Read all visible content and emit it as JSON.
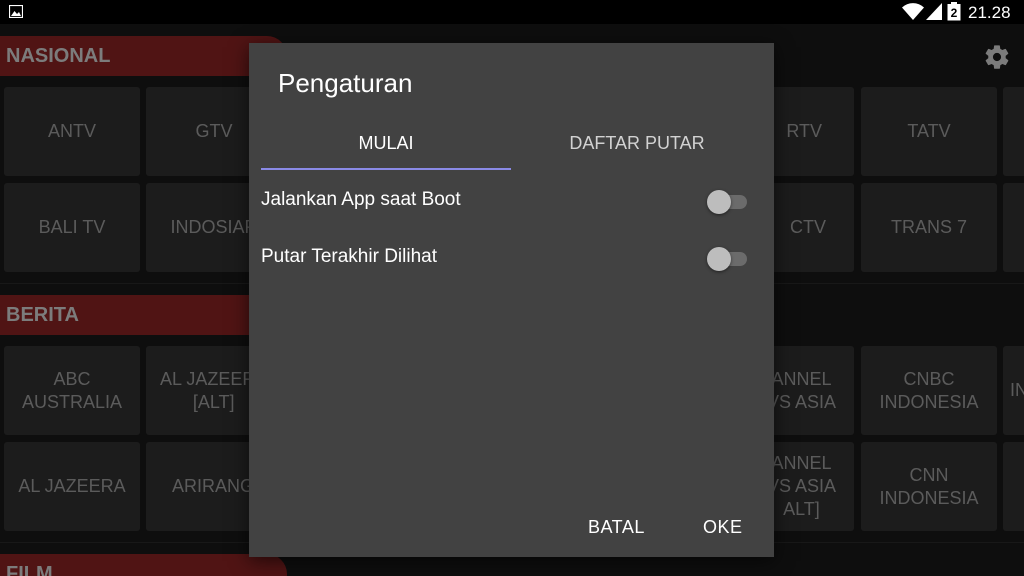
{
  "status_bar": {
    "time": "21.28",
    "icons": [
      "gallery-icon",
      "wifi-icon",
      "signal-icon",
      "battery-icon"
    ]
  },
  "categories": [
    {
      "title": "NASIONAL",
      "rows": [
        [
          "ANTV",
          "GTV",
          "",
          "",
          "",
          "RTV",
          "TATV"
        ],
        [
          "BALI TV",
          "INDOSIAR",
          "",
          "",
          "",
          "CTV",
          "TRANS 7"
        ]
      ]
    },
    {
      "title": "BERITA",
      "rows": [
        [
          "ABC\nAUSTRALIA",
          "AL JAZEERA\n[ALT]",
          "",
          "",
          "",
          "ANNEL\nVS ASIA",
          "CNBC\nINDONESIA",
          "IN"
        ],
        [
          "AL JAZEERA",
          "ARIRANG",
          "",
          "",
          "",
          "ANNEL\nVS ASIA\nALT]",
          "CNN\nINDONESIA"
        ]
      ]
    },
    {
      "title": "FILM",
      "rows": []
    }
  ],
  "colors": {
    "category_header": "#7c1f1f",
    "tile": "#2c2c2c",
    "dialog": "#424242",
    "tab_indicator": "#8a8ae6"
  },
  "dialog": {
    "title": "Pengaturan",
    "tabs": [
      {
        "label": "MULAI",
        "selected": true
      },
      {
        "label": "DAFTAR PUTAR",
        "selected": false
      }
    ],
    "settings": [
      {
        "label": "Jalankan App saat Boot",
        "enabled": false
      },
      {
        "label": "Putar Terakhir Dilihat",
        "enabled": false
      }
    ],
    "buttons": {
      "cancel": "BATAL",
      "ok": "OKE"
    }
  }
}
